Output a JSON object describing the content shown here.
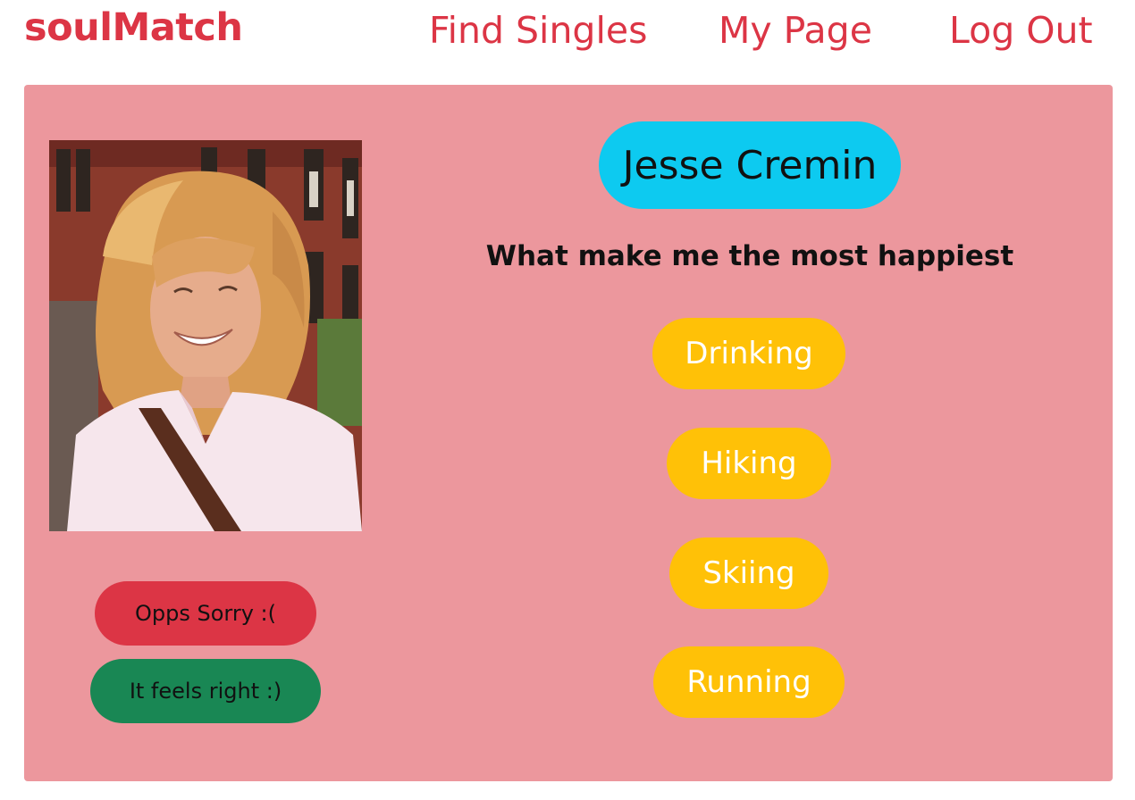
{
  "nav": {
    "brand": "soulMatch",
    "links": [
      "Find Singles",
      "My Page",
      "Log Out"
    ]
  },
  "profile": {
    "name": "Jesse Cremin",
    "headline": "What make me the most happiest",
    "hobbies": [
      "Drinking",
      "Hiking",
      "Skiing",
      "Running"
    ],
    "photo": "profile-photo-woman-smiling"
  },
  "actions": {
    "reject_label": "Opps Sorry :(",
    "accept_label": "It feels right :)"
  },
  "colors": {
    "brand": "#dc3545",
    "card_background": "#ec979d",
    "name_pill": "#0dcaf0",
    "hobby_pill": "#ffc107",
    "reject_button": "#dc3545",
    "accept_button": "#198754"
  }
}
